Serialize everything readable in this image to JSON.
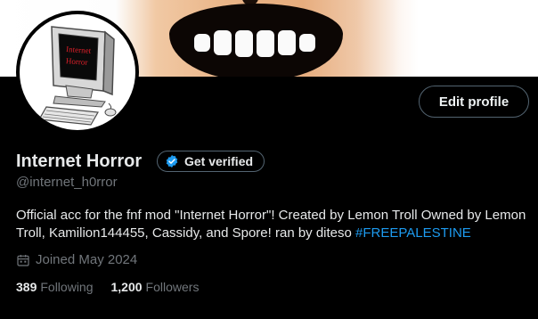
{
  "profile": {
    "display_name": "Internet Horror",
    "handle": "@internet_h0rror",
    "verify_label": "Get verified",
    "edit_label": "Edit profile",
    "bio_text": "Official acc for the fnf mod \"Internet Horror\"! Created by Lemon Troll Owned by Lemon Troll, Kamilion144455, Cassidy, and Spore! ran by diteso ",
    "bio_hashtag": "#FREEPALESTINE",
    "joined": "Joined May 2024",
    "avatar_screen_text": [
      "Internet",
      "Horror"
    ]
  },
  "stats": {
    "following_count": "389",
    "following_label": "Following",
    "followers_count": "1,200",
    "followers_label": "Followers"
  },
  "icons": {
    "verify": "verified-badge-icon",
    "joined": "calendar-icon"
  },
  "colors": {
    "background": "#000000",
    "accent": "#1d9bf0",
    "muted": "#71767b",
    "avatar_screen_text": "#e0202a"
  }
}
